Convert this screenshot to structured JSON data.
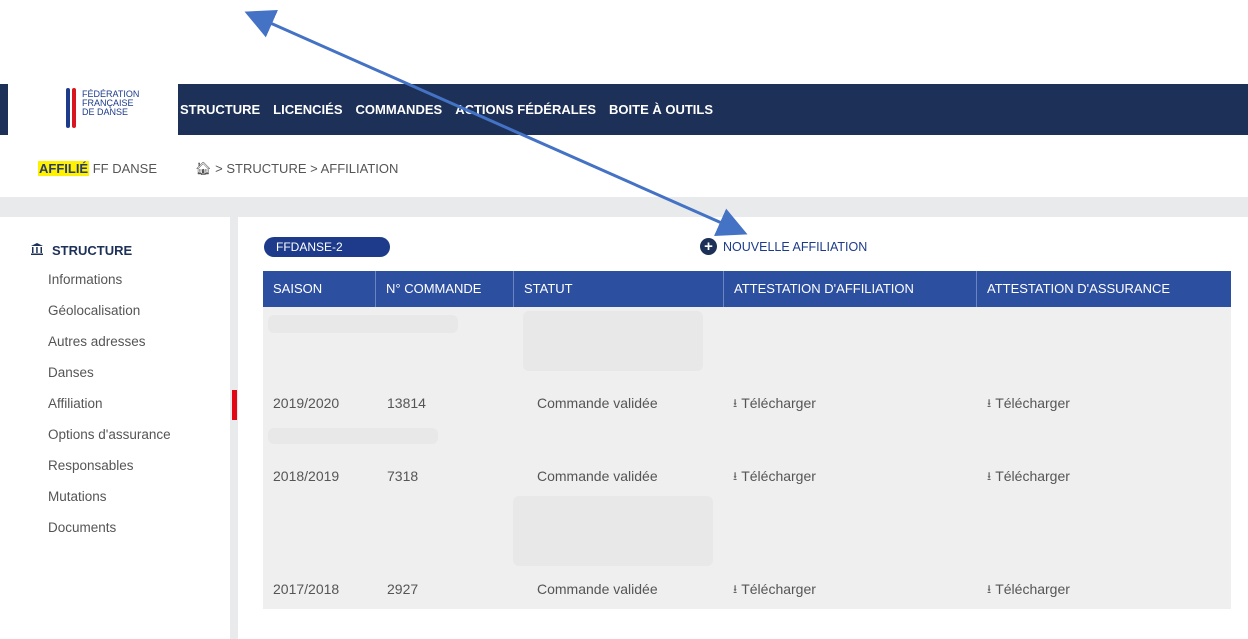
{
  "header": {
    "logo_lines": [
      "FÉDÉRATION",
      "FRANÇAISE",
      "DE DANSE"
    ],
    "nav": [
      "STRUCTURE",
      "LICENCIÉS",
      "COMMANDES",
      "ACTIONS FÉDÉRALES",
      "BOITE À OUTILS"
    ]
  },
  "breadcrumb": {
    "badge_strong": "AFFILIÉ",
    "badge_rest": "FF DANSE",
    "home_icon": "home-icon",
    "path": "> STRUCTURE > AFFILIATION"
  },
  "sidebar": {
    "title": "STRUCTURE",
    "items": [
      "Informations",
      "Géolocalisation",
      "Autres adresses",
      "Danses",
      "Affiliation",
      "Options d'assurance",
      "Responsables",
      "Mutations",
      "Documents"
    ]
  },
  "main": {
    "pill_label": "FFDANSE-2",
    "new_affiliation": "NOUVELLE AFFILIATION",
    "columns": [
      "SAISON",
      "N° COMMANDE",
      "STATUT",
      "ATTESTATION D'AFFILIATION",
      "ATTESTATION D'ASSURANCE"
    ],
    "rows": [
      {
        "saison": "2019/2020",
        "commande": "13814",
        "statut": "Commande validée",
        "affiliation": "Télécharger",
        "assurance": "Télécharger"
      },
      {
        "saison": "2018/2019",
        "commande": "7318",
        "statut": "Commande validée",
        "affiliation": "Télécharger",
        "assurance": "Télécharger"
      },
      {
        "saison": "2017/2018",
        "commande": "2927",
        "statut": "Commande validée",
        "affiliation": "Télécharger",
        "assurance": "Télécharger"
      }
    ]
  },
  "colors": {
    "navbar": "#1d3058",
    "table_header": "#2d4fa0",
    "highlight": "#fff200",
    "active_marker": "#e30613",
    "arrow": "#4472c4"
  }
}
